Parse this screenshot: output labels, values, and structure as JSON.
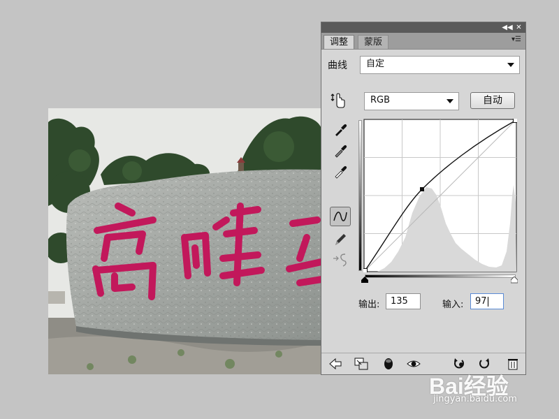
{
  "panel": {
    "tabs": [
      {
        "label": "调整",
        "active": true
      },
      {
        "label": "蒙版",
        "active": false
      }
    ],
    "collapse_icon": "double-chevron-right-icon",
    "close_icon": "close-icon",
    "menu_icon": "panel-menu-icon"
  },
  "curves": {
    "label": "曲线",
    "preset_value": "自定",
    "channel_value": "RGB",
    "auto_label": "自动",
    "output_label": "输出:",
    "output_value": "135",
    "input_label": "输入:",
    "input_value": "97",
    "control_point": {
      "input": 97,
      "output": 135
    }
  },
  "tools": [
    {
      "name": "on-image-adjust-icon"
    },
    {
      "name": "black-point-eyedropper-icon"
    },
    {
      "name": "gray-point-eyedropper-icon"
    },
    {
      "name": "white-point-eyedropper-icon"
    },
    {
      "name": "curve-edit-icon",
      "active": true
    },
    {
      "name": "pencil-draw-icon"
    },
    {
      "name": "smooth-curve-icon"
    }
  ],
  "bottom_icons": [
    "back-arrow-icon",
    "clip-to-layer-icon",
    "layer-visibility-mask-icon",
    "eye-icon",
    "previous-state-icon",
    "reset-icon",
    "trash-icon"
  ],
  "watermark": {
    "brand": "Bai经验",
    "url": "jingyan.baidu.com"
  },
  "colors": {
    "panel_bg": "#d6d6d6",
    "title_bar": "#5a5a5a",
    "tab_bar": "#9d9d9d",
    "text_pink": "#c2185b"
  }
}
